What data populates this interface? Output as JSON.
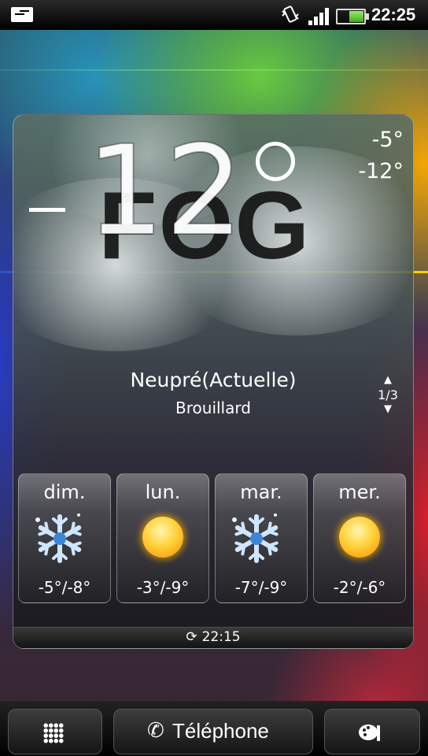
{
  "status_bar": {
    "time": "22:25",
    "icons": [
      "notification-message-icon",
      "vibrate-icon",
      "signal-icon",
      "battery-icon"
    ]
  },
  "weather": {
    "condition_banner": "FOG",
    "current_temp_sign": "-",
    "current_temp": "12",
    "high": "-5°",
    "low": "-12°",
    "location": "Neupré(Actuelle)",
    "condition": "Brouillard",
    "pager": "1/3",
    "forecast": [
      {
        "day": "dim.",
        "icon": "snow-icon",
        "temps": "-5°/-8°"
      },
      {
        "day": "lun.",
        "icon": "sun-icon",
        "temps": "-3°/-9°"
      },
      {
        "day": "mar.",
        "icon": "snow-icon",
        "temps": "-7°/-9°"
      },
      {
        "day": "mer.",
        "icon": "sun-icon",
        "temps": "-2°/-6°"
      }
    ],
    "last_update": "22:15"
  },
  "dock": {
    "phone_label": "Téléphone",
    "icons": [
      "all-apps-icon",
      "phone-icon",
      "personalize-icon"
    ]
  },
  "colors": {
    "status_bar_bg": "#000000",
    "accent_line": "#c8d020"
  }
}
